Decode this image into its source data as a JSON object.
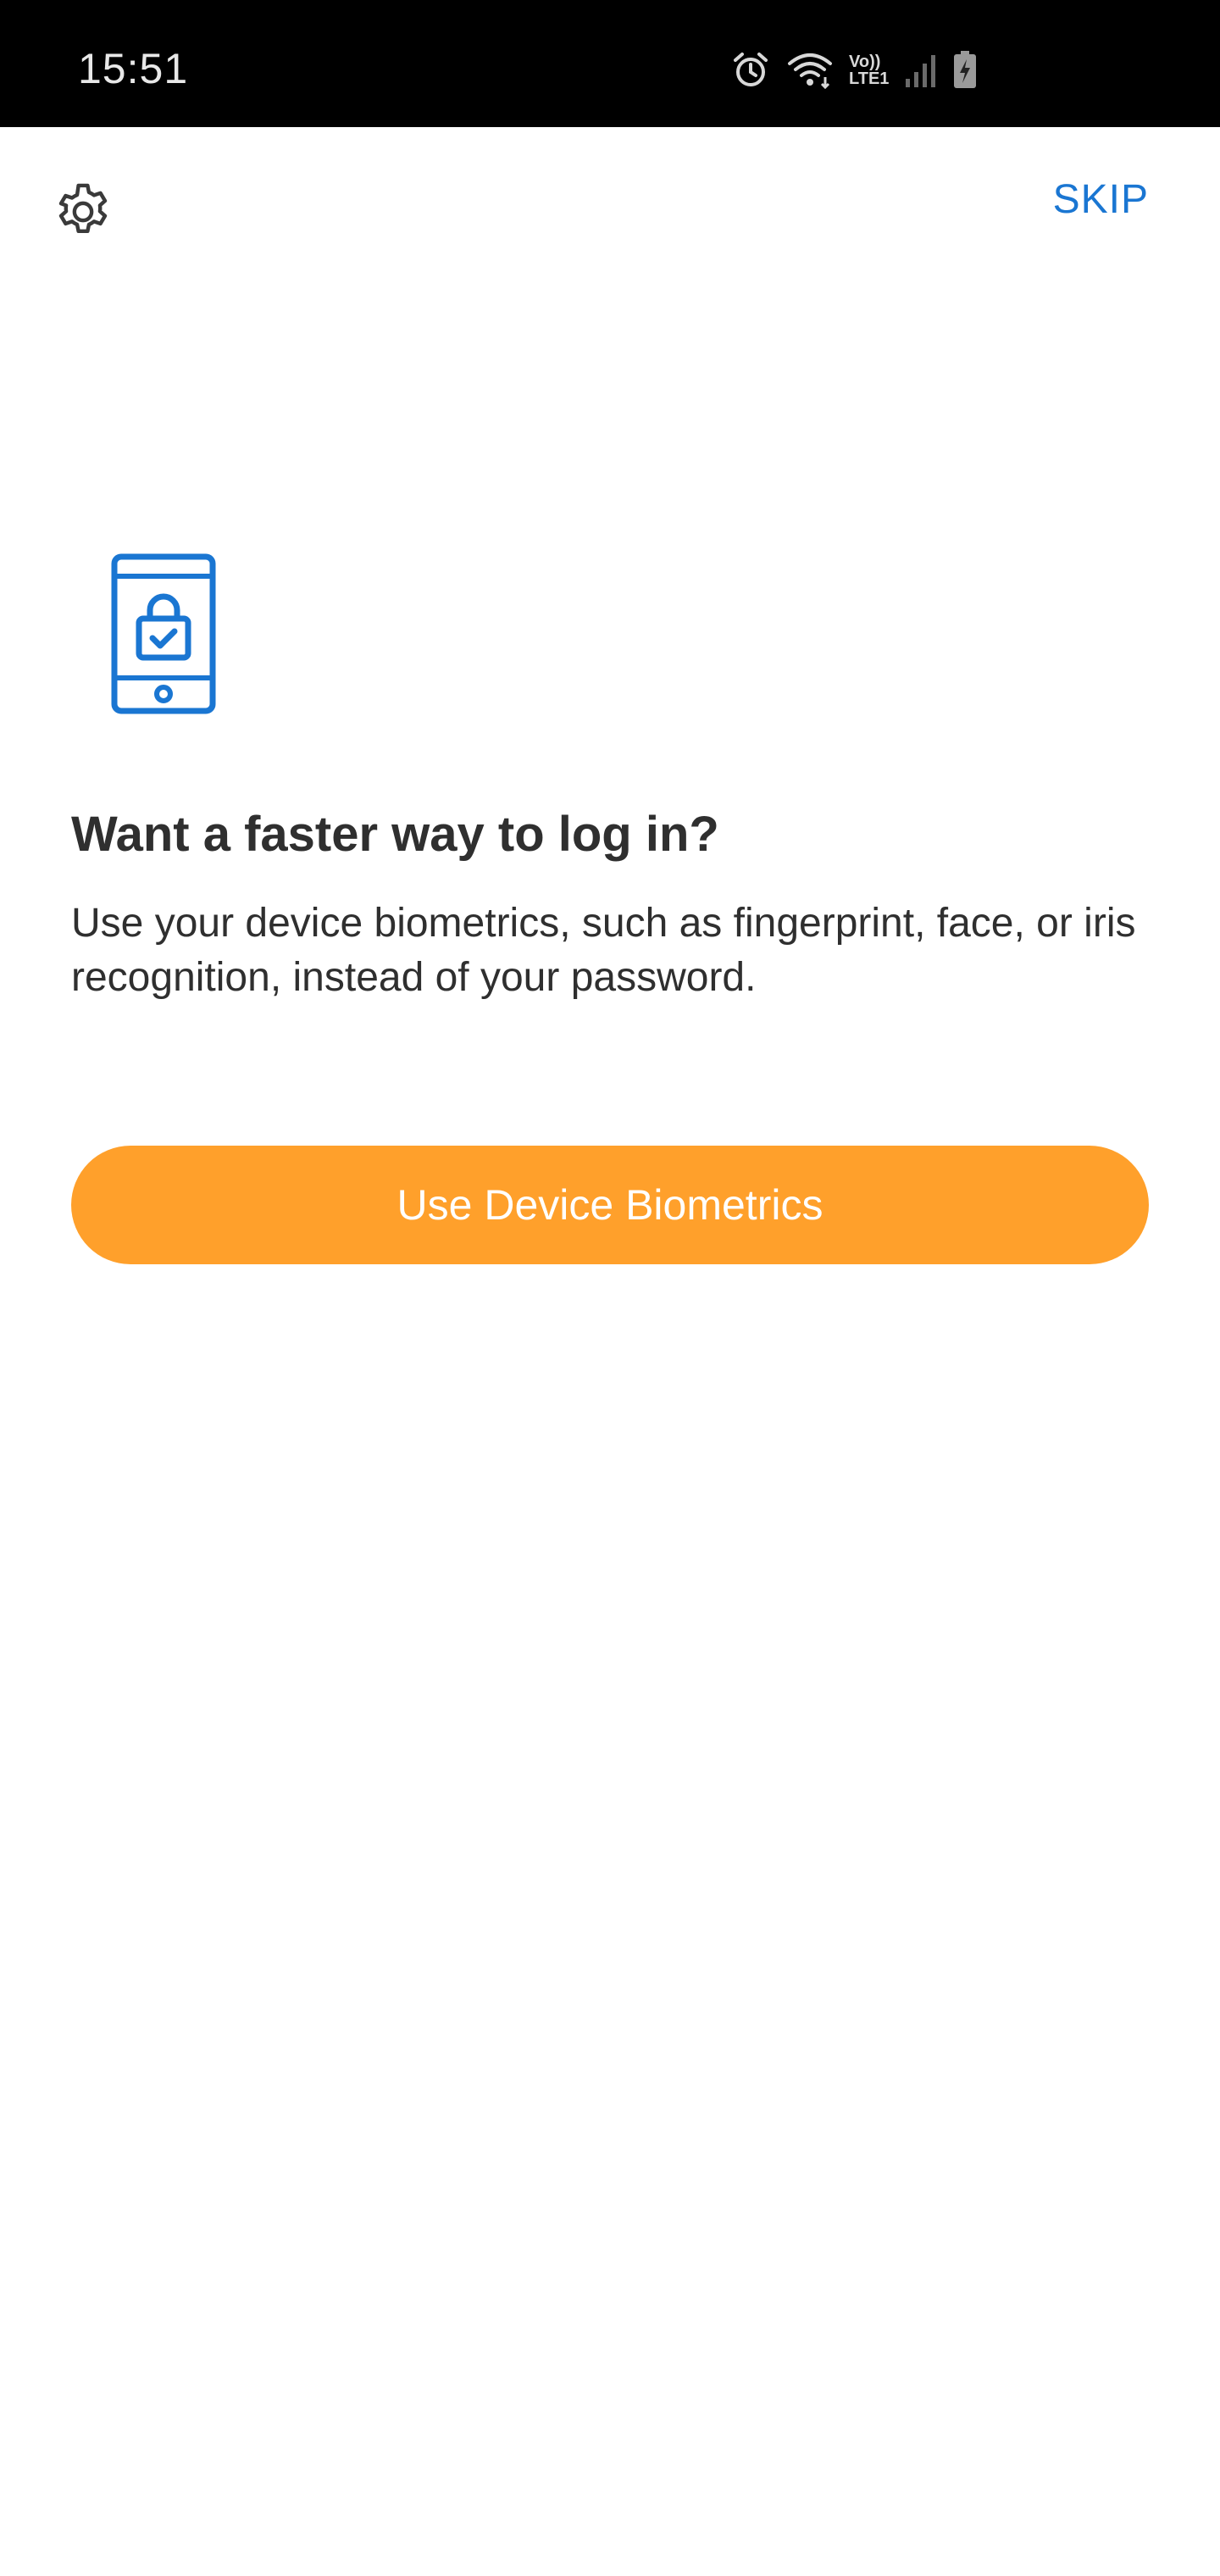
{
  "status_bar": {
    "time": "15:51",
    "icons": [
      "alarm-icon",
      "wifi-icon",
      "volte-lte-icon",
      "signal-icon",
      "battery-charging-icon"
    ],
    "volte_top": "Vo))",
    "volte_bottom": "LTE1"
  },
  "top_bar": {
    "settings_icon": "gear-icon",
    "skip_label": "SKIP"
  },
  "content": {
    "hero_icon": "phone-lock-icon",
    "headline": "Want a faster way to log in?",
    "description": "Use your device biometrics, such as fingerprint, face, or iris recognition, instead of your password.",
    "primary_button_label": "Use Device Biometrics"
  },
  "colors": {
    "accent": "#1a76d2",
    "button": "#ffa02b",
    "text": "#2f2f2f",
    "status_bar_bg": "#000000"
  }
}
